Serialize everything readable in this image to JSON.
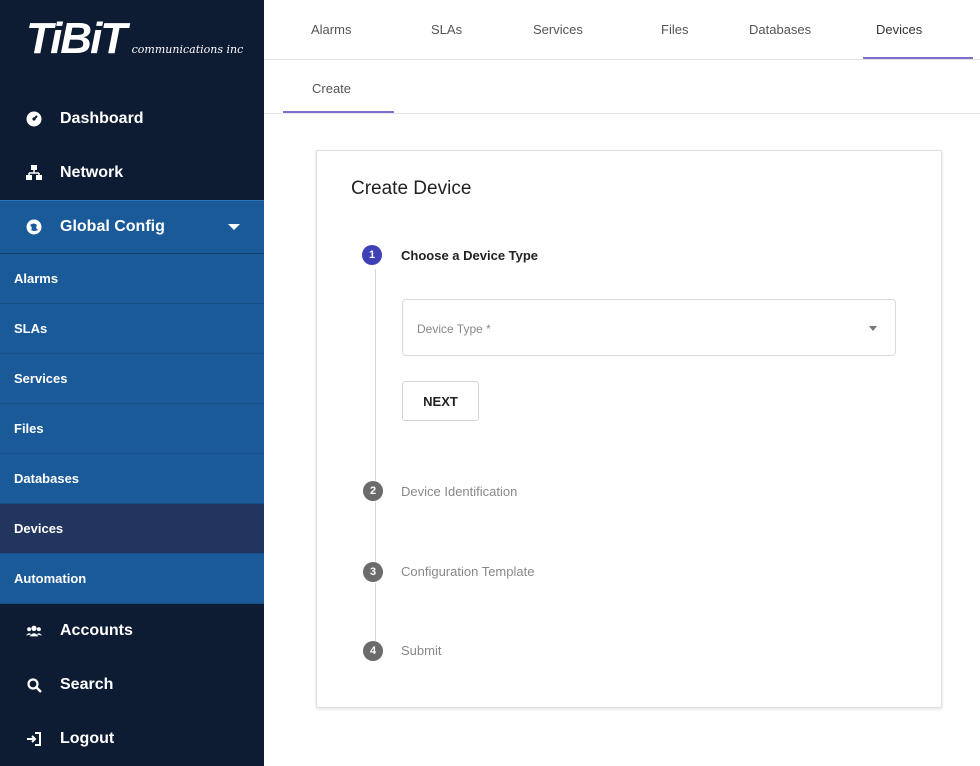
{
  "sidebar": {
    "logo": {
      "main": "TiBiT",
      "sub": "communications inc"
    },
    "top_items": [
      {
        "label": "Dashboard",
        "icon": "dashboard-icon"
      },
      {
        "label": "Network",
        "icon": "network-icon"
      }
    ],
    "group": {
      "label": "Global Config",
      "icon": "globe-icon"
    },
    "sub_items": [
      {
        "label": "Alarms"
      },
      {
        "label": "SLAs"
      },
      {
        "label": "Services"
      },
      {
        "label": "Files"
      },
      {
        "label": "Databases"
      },
      {
        "label": "Devices",
        "active": true
      },
      {
        "label": "Automation"
      }
    ],
    "bottom_items": [
      {
        "label": "Accounts",
        "icon": "accounts-icon"
      },
      {
        "label": "Search",
        "icon": "search-icon"
      },
      {
        "label": "Logout",
        "icon": "logout-icon"
      }
    ]
  },
  "tabs": {
    "items": [
      "Alarms",
      "SLAs",
      "Services",
      "Files",
      "Databases",
      "Devices"
    ],
    "active": "Devices",
    "subtab": "Create"
  },
  "card": {
    "title": "Create Device",
    "steps": [
      {
        "number": "1",
        "label": "Choose a Device Type",
        "active": true
      },
      {
        "number": "2",
        "label": "Device Identification",
        "active": false
      },
      {
        "number": "3",
        "label": "Configuration Template",
        "active": false
      },
      {
        "number": "4",
        "label": "Submit",
        "active": false
      }
    ],
    "device_type_placeholder": "Device Type *",
    "next_label": "NEXT"
  },
  "colors": {
    "sidebar_bg": "#0d1b33",
    "group_bg": "#1a5a99",
    "active_sub_bg": "#22355e",
    "accent": "#7b6fcf",
    "step_active": "#3d41b5",
    "step_inactive": "#6b6b6b"
  }
}
